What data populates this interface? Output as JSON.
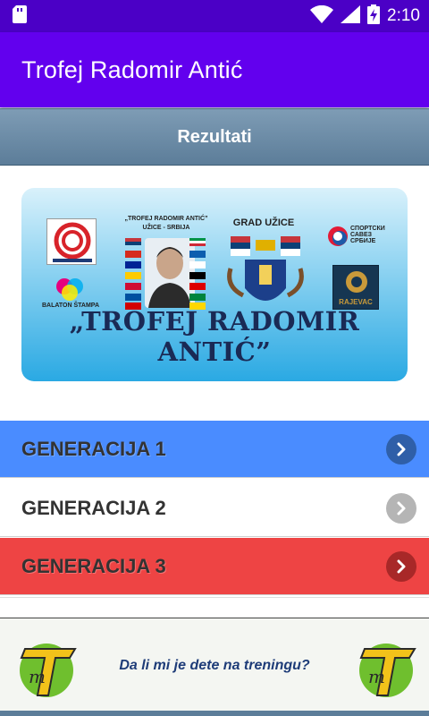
{
  "status_bar": {
    "time": "2:10",
    "icons": [
      "sd-card-icon",
      "wifi-icon",
      "signal-icon",
      "battery-charging-icon"
    ]
  },
  "app_bar": {
    "title": "Trofej Radomir Antić"
  },
  "section": {
    "title": "Rezultati"
  },
  "banner": {
    "main_title": "„TROFEJ RADOMIR ANTIĆ”",
    "caption_trophy": "„TROFEJ RADOMIR ANTIĆ”",
    "caption_city_sub": "UŽICE - SRBIJA",
    "caption_grad": "GRAD UŽICE",
    "caption_sport": "СПОРТСКИ САВЕЗ СРБИЈЕ",
    "caption_balaton": "BALATON ŠTAMPA",
    "caption_rajevac": "RAJEVAC"
  },
  "menu": [
    {
      "label": "GENERACIJA 1",
      "color": "#4a8cff",
      "chevron_color": "#2f5fa8"
    },
    {
      "label": "GENERACIJA 2",
      "color": "#ffffff",
      "chevron_color": "#b5b5b5"
    },
    {
      "label": "GENERACIJA 3",
      "color": "#ee4444",
      "chevron_color": "#a82828"
    }
  ],
  "ad": {
    "text": "Da li mi je dete na treningu?"
  },
  "colors": {
    "status_bar": "#4b00c6",
    "app_bar": "#6200ee"
  }
}
